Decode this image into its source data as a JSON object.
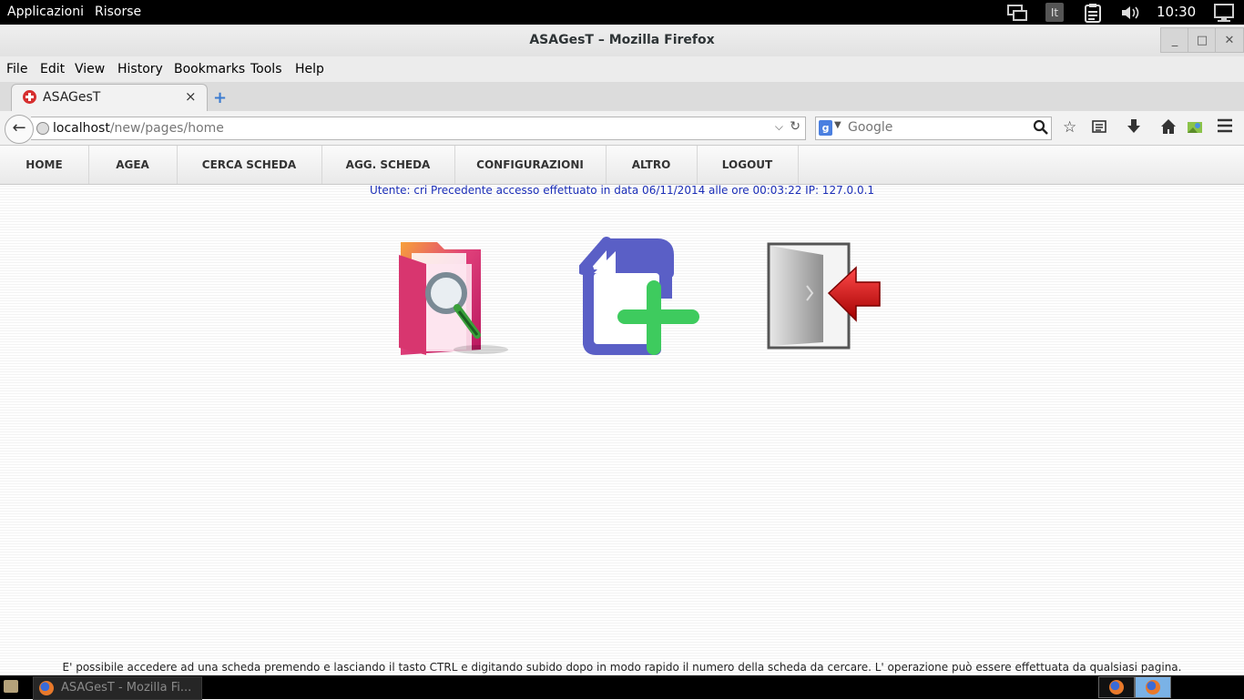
{
  "top_panel": {
    "menu": [
      "Applicazioni",
      "Risorse"
    ],
    "keyboard_layout": "It",
    "clock": "10:30",
    "tray_icons": [
      "network-icon",
      "keyboard-layout-icon",
      "clipboard-icon",
      "volume-icon",
      "clock",
      "user-monitor-icon"
    ]
  },
  "window": {
    "title": "ASAGesT – Mozilla Firefox",
    "controls": [
      "minimize-icon",
      "maximize-icon",
      "close-icon"
    ]
  },
  "menubar": [
    "File",
    "Edit",
    "View",
    "History",
    "Bookmarks",
    "Tools",
    "Help"
  ],
  "tabs": [
    {
      "label": "ASAGesT",
      "close": "×"
    }
  ],
  "new_tab": "+",
  "navbar": {
    "url_host": "localhost",
    "url_path": "/new/pages/home",
    "search_placeholder": "Google",
    "search_engine": "g",
    "icons": [
      "bookmark-star-icon",
      "reading-list-icon",
      "download-icon",
      "home-icon",
      "sync-icon",
      "menu-icon"
    ]
  },
  "site_nav": [
    "HOME",
    "AGEA",
    "CERCA SCHEDA",
    "AGG. SCHEDA",
    "CONFIGURAZIONI",
    "ALTRO",
    "LOGOUT"
  ],
  "user_info": "Utente: cri Precedente accesso effettuato in data 06/11/2014 alle ore 00:03:22 IP: 127.0.0.1",
  "shortcuts": [
    "search-folder-icon",
    "add-document-icon",
    "logout-door-icon"
  ],
  "footer_note": "E' possibile accedere ad una scheda premendo e lasciando il tasto CTRL e digitando subido dopo in modo rapido il numero della scheda da cercare. L' operazione può essere effettuata da qualsiasi pagina.",
  "taskbar": {
    "task_label": "ASAGesT - Mozilla Fi..."
  }
}
